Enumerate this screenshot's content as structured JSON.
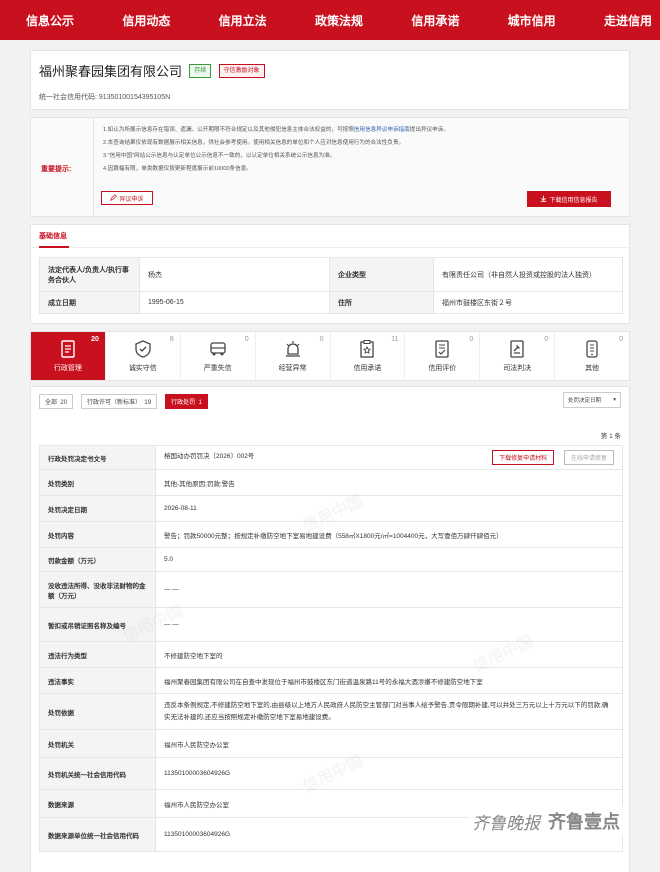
{
  "nav": [
    "信息公示",
    "信用动态",
    "信用立法",
    "政策法规",
    "信用承诺",
    "城市信用",
    "走进信用"
  ],
  "company": {
    "name": "福州聚春园集团有限公司",
    "status_badge": "存续",
    "tag_badge": "守信激励对象",
    "code_label": "统一社会信用代码:",
    "code_value": "91350100154395105N"
  },
  "notice": {
    "label": "重要提示:",
    "line1a": "1.如认为所展示信息存在错误、遗漏、公开期限不符合规定以及其他侵犯信息主体合法权益的，可按照",
    "line1link": "信用信息异议申诉指南",
    "line1b": "提出异议申诉。",
    "line2": "2.本查询结果仅依现有数据展示相关信息，供社会参考使用。使用相关信息的单位和个人应对信息使用行为的合法性负责。",
    "line3": "3.\"信用中国\"网站公示信息与认定单位公示信息不一致的，以认定单位相关系统公示信息为准。",
    "line4": "4.因篇幅有限，单类数据仅按更新程度展示前10000条信息。",
    "appeal_btn": "异议申诉",
    "report_btn": "下载信用信息报告"
  },
  "basic": {
    "title": "基础信息",
    "legal_label": "法定代表人/负责人/执行事务合伙人",
    "legal_value": "杨杰",
    "type_label": "企业类型",
    "type_value": "有限责任公司（非自然人投资或控股的法人独资）",
    "date_label": "成立日期",
    "date_value": "1995-06-15",
    "addr_label": "住所",
    "addr_value": "福州市鼓楼区东街２号"
  },
  "tabs": [
    {
      "label": "行政管理",
      "count": "20",
      "icon": "document-icon"
    },
    {
      "label": "诚实守信",
      "count": "8",
      "icon": "shield-icon"
    },
    {
      "label": "严重失信",
      "count": "0",
      "icon": "bus-icon"
    },
    {
      "label": "经营异常",
      "count": "0",
      "icon": "alarm-icon"
    },
    {
      "label": "信用承诺",
      "count": "11",
      "icon": "commitment-icon"
    },
    {
      "label": "信用评价",
      "count": "0",
      "icon": "evaluation-icon"
    },
    {
      "label": "司法判决",
      "count": "0",
      "icon": "gavel-icon"
    },
    {
      "label": "其他",
      "count": "0",
      "icon": "phone-icon"
    }
  ],
  "filters": [
    {
      "label": "全部",
      "count": "20"
    },
    {
      "label": "行政许可（新标准）",
      "count": "19"
    },
    {
      "label": "行政处罚",
      "count": "1"
    }
  ],
  "sort_label": "处罚决定日期",
  "row_count": "第 1 条",
  "detail": {
    "download_btn": "下载修复申请材料",
    "online_fix_btn": "在线申请修复",
    "rows": [
      {
        "k": "行政处罚决定书文号",
        "v": "榕国动办罚罚决〔2026〕002号"
      },
      {
        "k": "处罚类别",
        "v": "其他-其他原因;罚款;警告"
      },
      {
        "k": "处罚决定日期",
        "v": "2026-08-11"
      },
      {
        "k": "处罚内容",
        "v": "警告；罚款50000元整；按规定补缴防空地下室易地建设费（558㎡X1800元/㎡=1004400元，大写壹佰万肆仟肆佰元）"
      },
      {
        "k": "罚款金额（万元）",
        "v": "5.0"
      },
      {
        "k": "没收违法所得、没收非法财物的金额（万元）",
        "v": "— —"
      },
      {
        "k": "暂扣或吊销证照名称及编号",
        "v": "— —"
      },
      {
        "k": "违法行为类型",
        "v": "不修建防空地下室的"
      },
      {
        "k": "违法事实",
        "v": "福州聚春园集团有限公司在自查中发现位于福州市鼓楼区东门街道温泉路11号的永福大酒涉嫌不修建防空地下室"
      },
      {
        "k": "处罚依据",
        "v": "违反本条例规定,不修建防空地下室的,由县级以上地方人民政府人民防空主管部门对当事人给予警告,责令限期补建,可以并处三万元以上十万元以下的罚款;确实无法补建的,还应当按照规定补缴防空地下室易地建设费。"
      },
      {
        "k": "处罚机关",
        "v": "福州市人民防空办公室"
      },
      {
        "k": "处罚机关统一社会信用代码",
        "v": "11350100003604926G"
      },
      {
        "k": "数据来源",
        "v": "福州市人民防空办公室"
      },
      {
        "k": "数据来源单位统一社会信用代码",
        "v": "11350100003604926G"
      }
    ]
  },
  "watermark": {
    "text": "信用中国",
    "logo1": "齐鲁晚报",
    "logo2": "齐鲁壹点"
  }
}
